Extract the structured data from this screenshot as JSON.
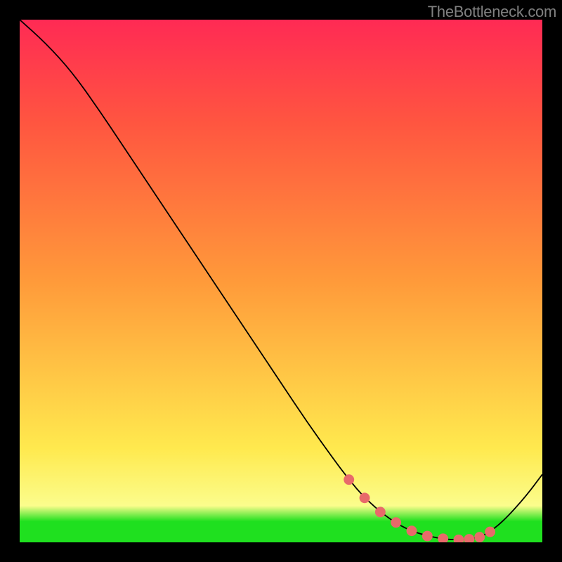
{
  "watermark": "TheBottleneck.com",
  "chart_data": {
    "type": "line",
    "title": "",
    "xlabel": "",
    "ylabel": "",
    "xlim": [
      0,
      100
    ],
    "ylim": [
      0,
      100
    ],
    "series": [
      {
        "name": "main-curve",
        "x": [
          0,
          5,
          10,
          15,
          20,
          25,
          30,
          35,
          40,
          45,
          50,
          55,
          60,
          63,
          66,
          70,
          74,
          78,
          82,
          85,
          88,
          90,
          93,
          97,
          100
        ],
        "y": [
          100,
          95.5,
          90,
          83,
          75.5,
          68,
          60.5,
          53,
          45.5,
          38,
          30.5,
          23,
          16,
          12,
          8.5,
          5,
          2.5,
          1.2,
          0.5,
          0.5,
          1,
          2,
          4.5,
          9,
          13
        ],
        "color": "#000000"
      },
      {
        "name": "highlight-dots",
        "x": [
          63,
          66,
          69,
          72,
          75,
          78,
          81,
          84,
          86,
          88,
          90
        ],
        "y": [
          12,
          8.5,
          5.8,
          3.8,
          2.2,
          1.2,
          0.7,
          0.5,
          0.6,
          1.0,
          2.0
        ],
        "color": "#e86a6a"
      }
    ],
    "background_gradient": {
      "stops": [
        {
          "pct": 0,
          "color": "#1fe01f"
        },
        {
          "pct": 4,
          "color": "#1fe01f"
        },
        {
          "pct": 7,
          "color": "#fbfd8c"
        },
        {
          "pct": 18,
          "color": "#ffe94e"
        },
        {
          "pct": 50,
          "color": "#ff9a3a"
        },
        {
          "pct": 80,
          "color": "#ff5640"
        },
        {
          "pct": 100,
          "color": "#ff2a54"
        }
      ]
    }
  }
}
